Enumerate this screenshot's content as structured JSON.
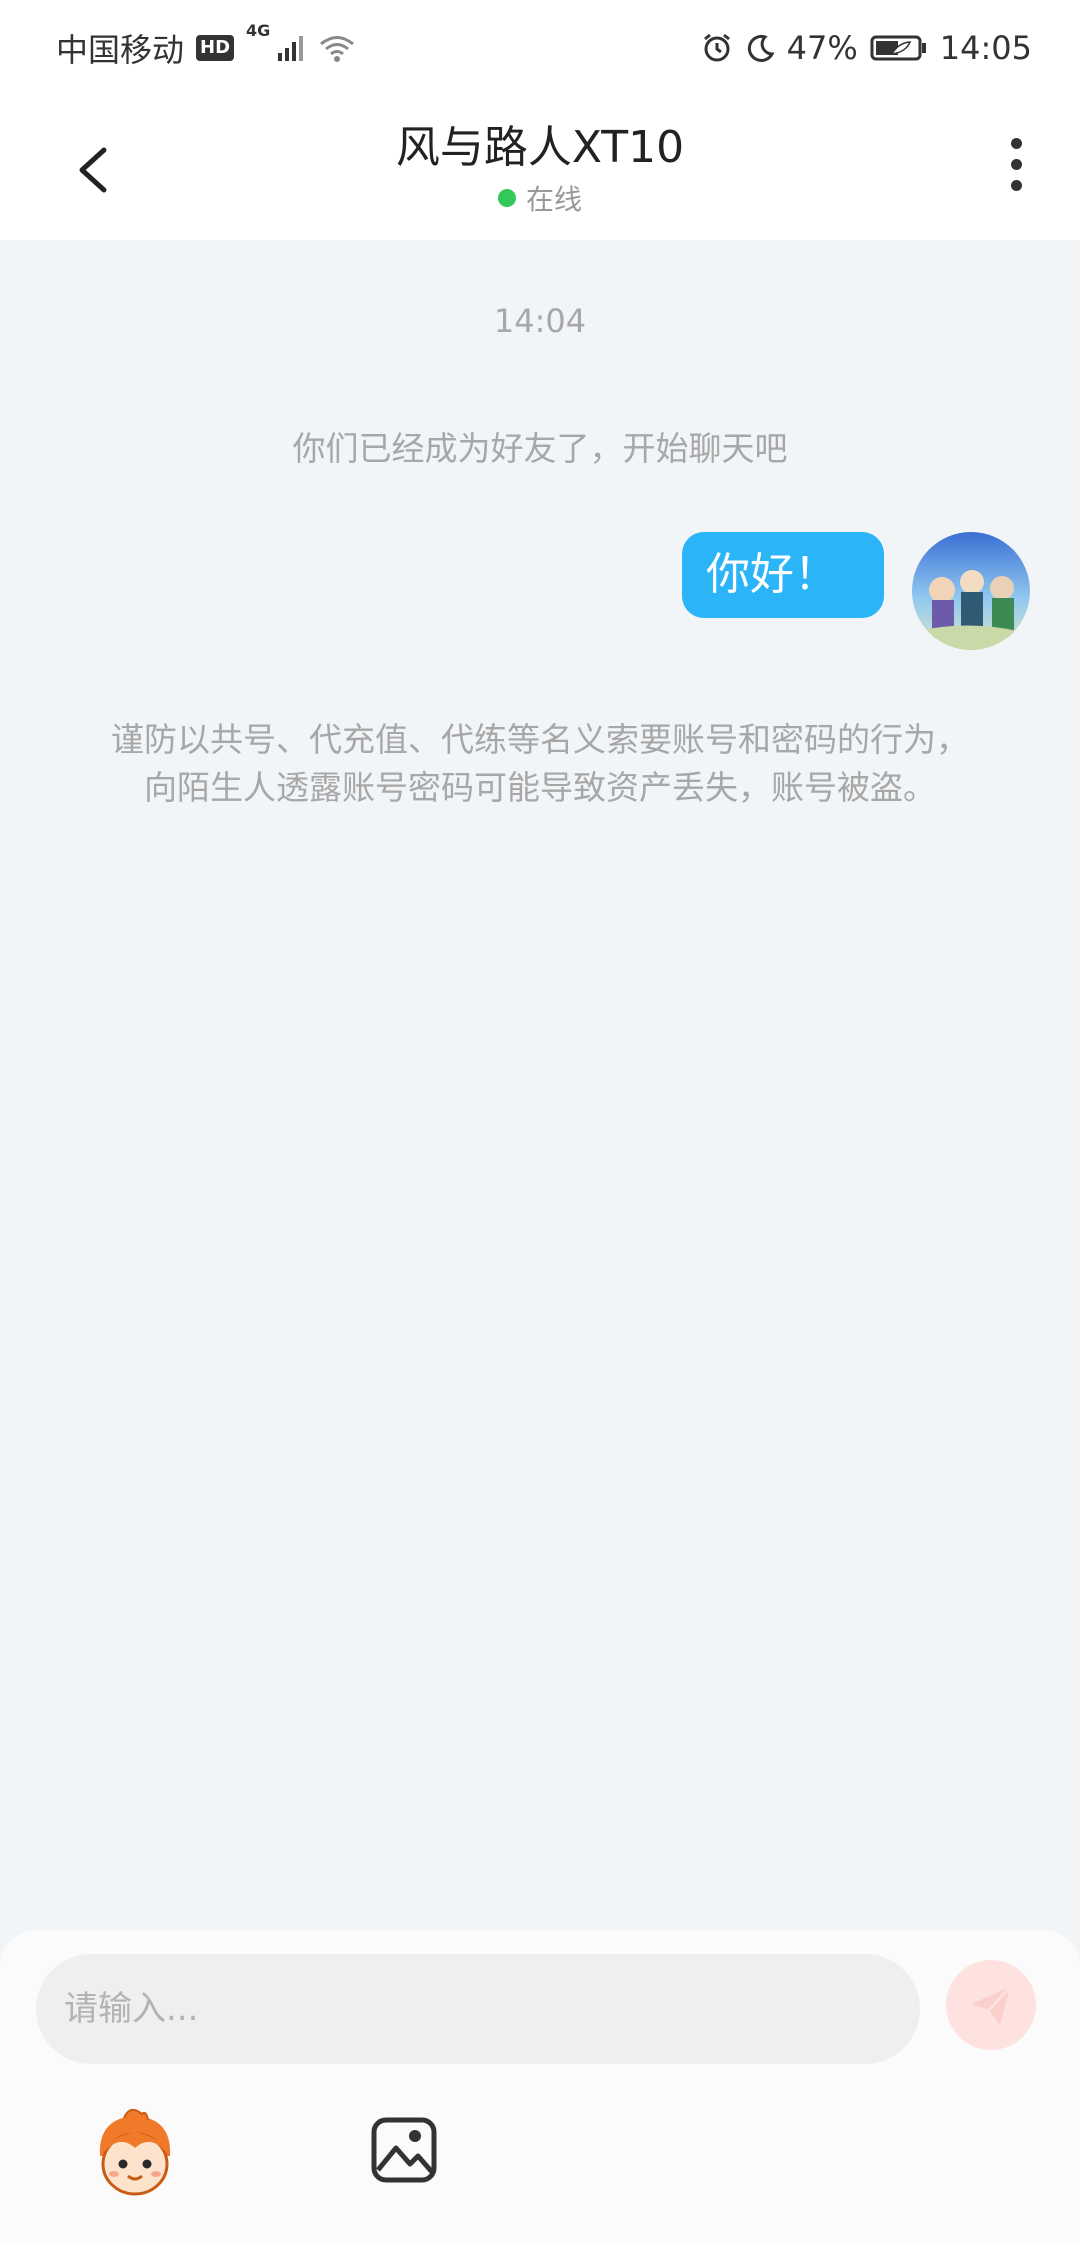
{
  "status_bar": {
    "carrier": "中国移动",
    "hd": "HD",
    "network": "4G",
    "battery": "47%",
    "time": "14:05"
  },
  "header": {
    "title": "风与路人XT10",
    "status": "在线"
  },
  "chat": {
    "time": "14:04",
    "system_message": "你们已经成为好友了，开始聊天吧",
    "messages": [
      {
        "text": "你好！",
        "from": "me"
      }
    ],
    "warning": "谨防以共号、代充值、代练等名义索要账号和密码的行为，向陌生人透露账号密码可能导致资产丢失，账号被盗。"
  },
  "composer": {
    "placeholder": "请输入..."
  },
  "colors": {
    "bubble": "#2bb4f7",
    "online": "#34c759",
    "send_button": "#fde2df",
    "background": "#f2f5f8"
  },
  "icons": [
    "back-arrow-icon",
    "more-vertical-icon",
    "send-icon",
    "emoji-mascot-icon",
    "image-icon",
    "alarm-icon",
    "moon-icon",
    "wifi-icon",
    "signal-icon",
    "battery-icon"
  ]
}
